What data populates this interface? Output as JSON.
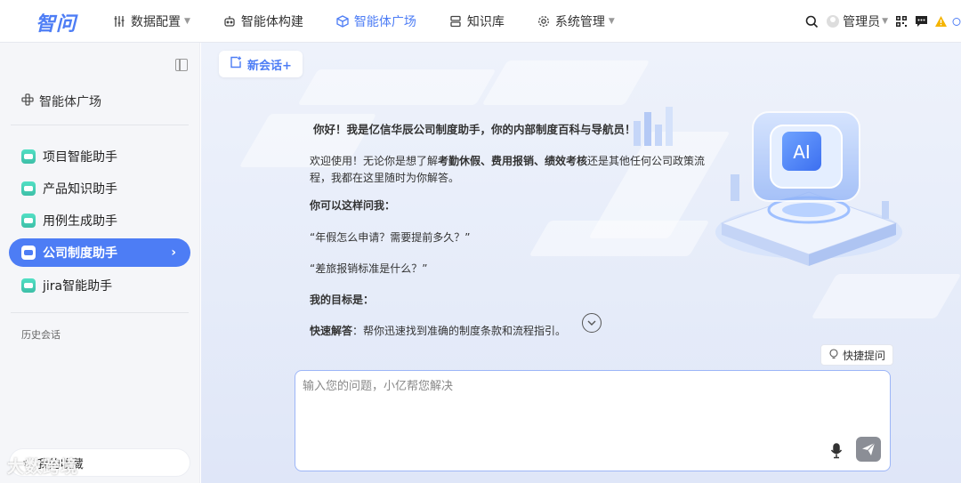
{
  "header": {
    "logo": "智问",
    "nav": [
      {
        "label": "数据配置",
        "icon": "sliders-icon",
        "dropdown": true,
        "active": false
      },
      {
        "label": "智能体构建",
        "icon": "robot-icon",
        "dropdown": false,
        "active": false
      },
      {
        "label": "智能体广场",
        "icon": "cube-icon",
        "dropdown": false,
        "active": true
      },
      {
        "label": "知识库",
        "icon": "database-icon",
        "dropdown": false,
        "active": false
      },
      {
        "label": "系统管理",
        "icon": "gear-icon",
        "dropdown": true,
        "active": false
      }
    ],
    "user_name": "管理员",
    "accent_color": "#4d7df5"
  },
  "sidebar": {
    "section_title": "智能体广场",
    "assistants": [
      {
        "label": "项目智能助手",
        "active": false
      },
      {
        "label": "产品知识助手",
        "active": false
      },
      {
        "label": "用例生成助手",
        "active": false
      },
      {
        "label": "公司制度助手",
        "active": true
      },
      {
        "label": "jira智能助手",
        "active": false
      }
    ],
    "history_label": "历史会话",
    "favorites_label": "我的收藏"
  },
  "main": {
    "new_chat_label": "新会话+",
    "illustration_text": "AI",
    "greeting_title": "你好！我是亿信华辰公司制度助手，你的内部制度百科与导航员！",
    "welcome_prefix": "欢迎使用！无论你是想了解",
    "welcome_bold": "考勤休假、费用报销、绩效考核",
    "welcome_suffix": "还是其他任何公司政策流程，我都在这里随时为你解答。",
    "ask_heading": "你可以这样问我：",
    "example_1": "“年假怎么申请？需要提前多久？”",
    "example_2": "“差旅报销标准是什么？”",
    "goal_heading": "我的目标是：",
    "goal_bold": "快速解答",
    "goal_text": "：帮你迅速找到准确的制度条款和流程指引。",
    "quick_ask_label": "快捷提问",
    "input_placeholder": "输入您的问题，小亿帮您解决"
  },
  "watermark": "大数跨境"
}
